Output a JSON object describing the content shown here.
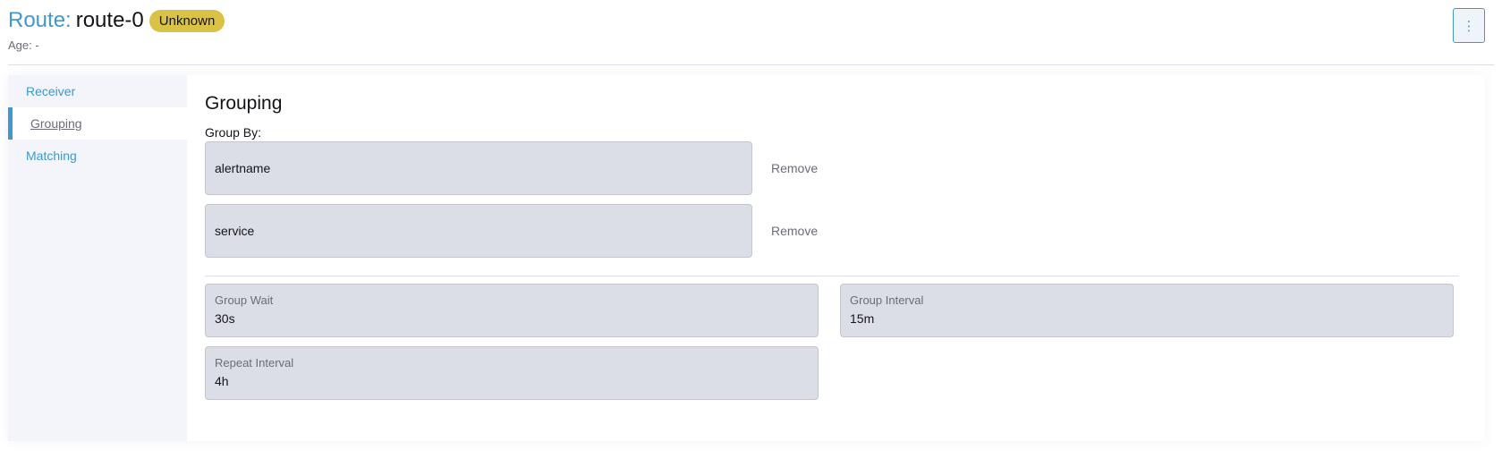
{
  "header": {
    "type_label": "Route:",
    "name": "route-0",
    "state_badge": "Unknown",
    "age_label": "Age:",
    "age_value": "-",
    "menu_label": "⋮"
  },
  "sidebar": {
    "tabs": [
      {
        "label": "Receiver",
        "active": false
      },
      {
        "label": "Grouping",
        "active": true
      },
      {
        "label": "Matching",
        "active": false
      }
    ]
  },
  "grouping": {
    "title": "Grouping",
    "group_by_label": "Group By:",
    "group_by": [
      {
        "value": "alertname",
        "remove_label": "Remove"
      },
      {
        "value": "service",
        "remove_label": "Remove"
      }
    ],
    "fields": [
      {
        "label": "Group Wait",
        "value": "30s"
      },
      {
        "label": "Group Interval",
        "value": "15m"
      },
      {
        "label": "Repeat Interval",
        "value": "4h"
      }
    ]
  },
  "colors": {
    "accent": "#3d98d3",
    "badge": "#dac342",
    "input_bg": "#dcdee7"
  }
}
